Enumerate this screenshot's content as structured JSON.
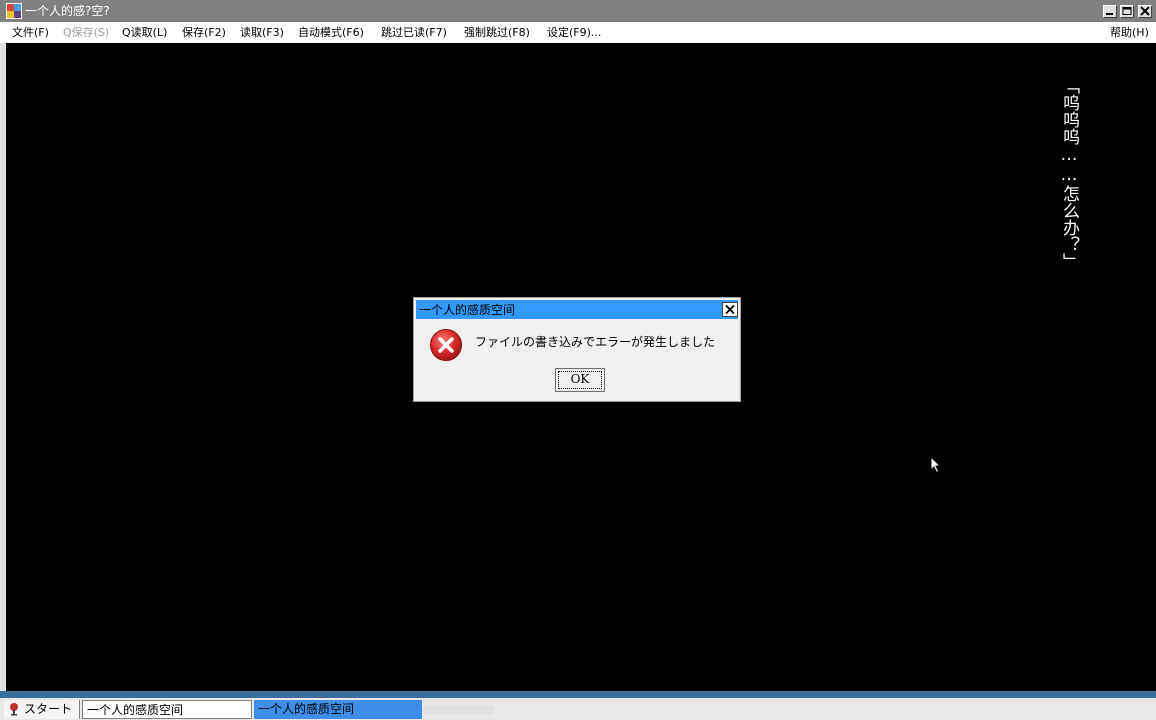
{
  "window": {
    "title": "一个人的感?空?"
  },
  "menu": {
    "items": [
      {
        "label": "文件(F)",
        "disabled": false
      },
      {
        "label": "Q保存(S)",
        "disabled": true
      },
      {
        "label": "Q读取(L)",
        "disabled": false
      },
      {
        "label": "保存(F2)",
        "disabled": false
      },
      {
        "label": "读取(F3)",
        "disabled": false
      },
      {
        "label": "自动模式(F6)",
        "disabled": false
      },
      {
        "label": "跳过已读(F7)",
        "disabled": false
      },
      {
        "label": "强制跳过(F8)",
        "disabled": false
      },
      {
        "label": "设定(F9)...",
        "disabled": false
      }
    ],
    "help": "帮助(H)"
  },
  "game": {
    "dialogue": "「呜呜呜……怎么办？」"
  },
  "dialog": {
    "title": "一个人的感质空间",
    "message": "ファイルの書き込みでエラーが発生しました",
    "ok_label": "OK"
  },
  "taskbar": {
    "start_label": "スタート",
    "tasks": [
      {
        "label": "一个人的感质空间",
        "active": false
      },
      {
        "label": "一个人的感质空间",
        "active": true
      }
    ]
  },
  "colors": {
    "title_bar": "#808080",
    "dialog_title": "#3399ff",
    "error_icon": "#d92b2b",
    "taskbar_accent": "#3a6e9a",
    "active_task": "#3d8ee8"
  },
  "icons": {
    "app": "app-icon",
    "error": "error-icon",
    "close": "close-icon",
    "cursor": "mouse-pointer-icon"
  }
}
